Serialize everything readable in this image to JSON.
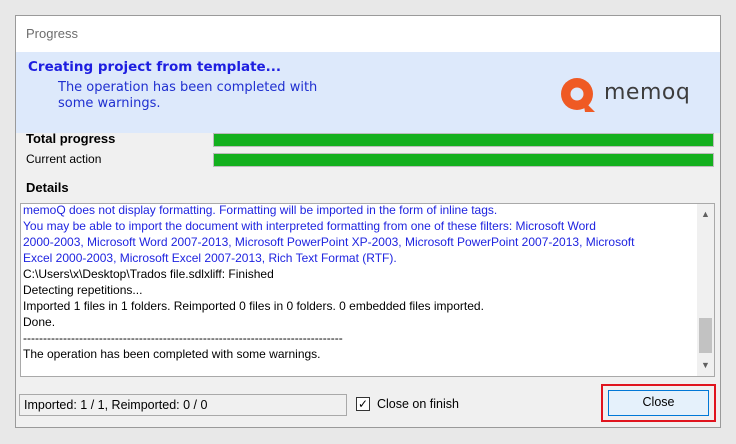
{
  "window": {
    "title": "Progress"
  },
  "banner": {
    "title": "Creating project from template...",
    "message": "The operation has been completed with some warnings.",
    "logo_text": "memoq",
    "logo_color": "#ef5a24"
  },
  "progress": {
    "total_label": "Total progress",
    "total_value": 1.0,
    "current_label": "Current action",
    "current_value": 1.0,
    "bar_color": "#14b01e"
  },
  "details": {
    "label": "Details",
    "lines": [
      {
        "text": "memoQ does not display formatting. Formatting will be imported in the form of inline tags.",
        "color": "blue"
      },
      {
        "text": "You may be able to import the document with interpreted formatting from one of these filters: Microsoft Word",
        "color": "blue"
      },
      {
        "text": "2000-2003, Microsoft Word 2007-2013, Microsoft PowerPoint XP-2003, Microsoft PowerPoint 2007-2013, Microsoft",
        "color": "blue"
      },
      {
        "text": "Excel 2000-2003, Microsoft Excel 2007-2013, Rich Text Format (RTF).",
        "color": "blue"
      },
      {
        "text": "C:\\Users\\x\\Desktop\\Trados file.sdlxliff: Finished",
        "color": "black"
      },
      {
        "text": "Detecting repetitions...",
        "color": "black"
      },
      {
        "text": "Imported 1 files in 1 folders. Reimported 0 files in 0 folders. 0 embedded files imported.",
        "color": "black"
      },
      {
        "text": "Done.",
        "color": "black"
      },
      {
        "text": "--------------------------------------------------------------------------------",
        "color": "black"
      },
      {
        "text": "The operation has been completed with some warnings.",
        "color": "black"
      }
    ]
  },
  "status": {
    "text": "Imported: 1 / 1, Reimported: 0 / 0"
  },
  "close_on_finish": {
    "label": "Close on finish",
    "checked": true
  },
  "close_button": {
    "label": "Close",
    "highlight_color": "#e0141e"
  }
}
